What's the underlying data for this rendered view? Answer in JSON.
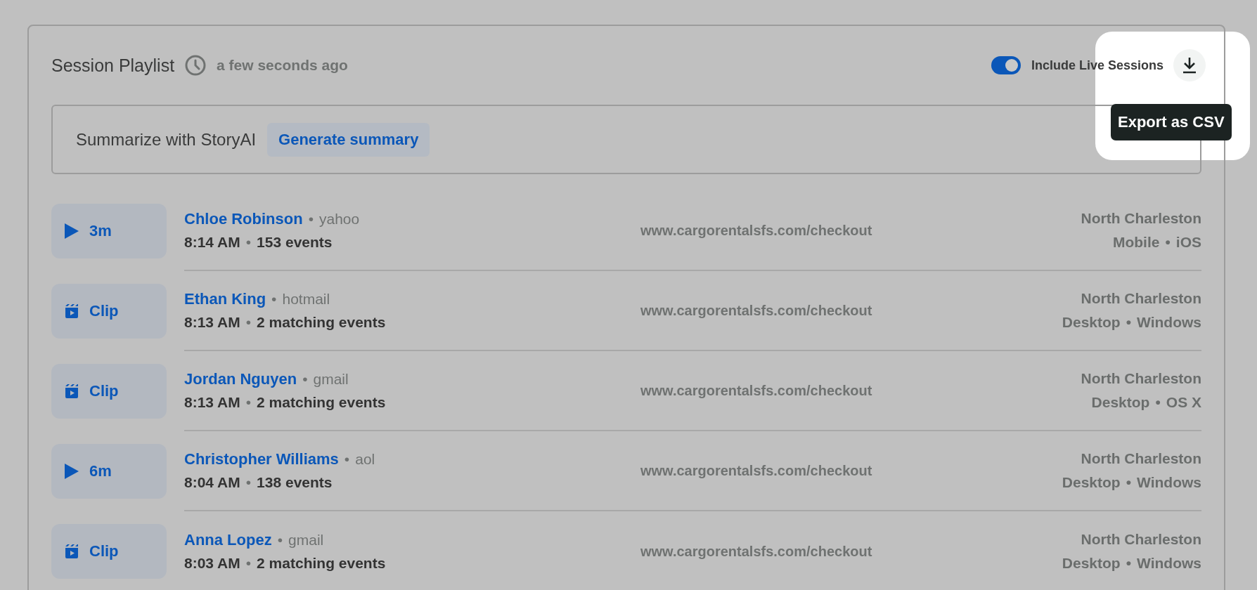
{
  "header": {
    "title": "Session Playlist",
    "updated": "a few seconds ago",
    "live_toggle": {
      "label": "Include Live Sessions",
      "on": true
    },
    "export": {
      "tooltip": "Export as CSV"
    }
  },
  "summary": {
    "label": "Summarize with StoryAI",
    "button": "Generate summary"
  },
  "separator": "•",
  "sessions": [
    {
      "kind": "play",
      "label": "3m",
      "name": "Chloe Robinson",
      "provider": "yahoo",
      "time": "8:14 AM",
      "events": "153 events",
      "url": "www.cargorentalsfs.com/checkout",
      "city": "North Charleston",
      "device": "Mobile",
      "os": "iOS"
    },
    {
      "kind": "clip",
      "label": "Clip",
      "name": "Ethan King",
      "provider": "hotmail",
      "time": "8:13 AM",
      "events": "2 matching events",
      "url": "www.cargorentalsfs.com/checkout",
      "city": "North Charleston",
      "device": "Desktop",
      "os": "Windows"
    },
    {
      "kind": "clip",
      "label": "Clip",
      "name": "Jordan Nguyen",
      "provider": "gmail",
      "time": "8:13 AM",
      "events": "2 matching events",
      "url": "www.cargorentalsfs.com/checkout",
      "city": "North Charleston",
      "device": "Desktop",
      "os": "OS X"
    },
    {
      "kind": "play",
      "label": "6m",
      "name": "Christopher Williams",
      "provider": "aol",
      "time": "8:04 AM",
      "events": "138 events",
      "url": "www.cargorentalsfs.com/checkout",
      "city": "North Charleston",
      "device": "Desktop",
      "os": "Windows"
    },
    {
      "kind": "clip",
      "label": "Clip",
      "name": "Anna Lopez",
      "provider": "gmail",
      "time": "8:03 AM",
      "events": "2 matching events",
      "url": "www.cargorentalsfs.com/checkout",
      "city": "North Charleston",
      "device": "Desktop",
      "os": "Windows"
    }
  ]
}
